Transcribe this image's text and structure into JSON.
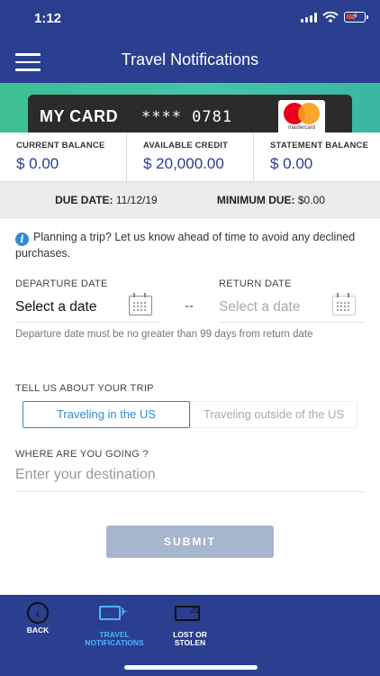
{
  "status_bar": {
    "time": "1:12"
  },
  "header": {
    "title": "Travel Notifications"
  },
  "card": {
    "name": "MY CARD",
    "number": "**** 0781",
    "brand_text": "mastercard"
  },
  "balances": [
    {
      "label": "CURRENT BALANCE",
      "value": "$ 0.00"
    },
    {
      "label": "AVAILABLE CREDIT",
      "value": "$ 20,000.00"
    },
    {
      "label": "STATEMENT BALANCE",
      "value": "$ 0.00"
    }
  ],
  "due": {
    "due_label": "DUE DATE:",
    "due_value": "11/12/19",
    "min_label": "MINIMUM DUE:",
    "min_value": "$0.00"
  },
  "info": {
    "icon": "i",
    "text": "Planning a trip? Let us know ahead of time to avoid any declined purchases."
  },
  "dates": {
    "departure_label": "DEPARTURE DATE",
    "departure_value": "Select a date",
    "separator": "--",
    "return_label": "RETURN DATE",
    "return_value": "Select a date",
    "hint": "Departure date must be no greater than 99 days from return date"
  },
  "trip": {
    "label": "TELL US ABOUT YOUR TRIP",
    "option_us": "Traveling in the US",
    "option_outside": "Traveling outside of the US",
    "selected": "Traveling in the US"
  },
  "destination": {
    "label": "WHERE ARE YOU GOING ?",
    "placeholder": "Enter your destination"
  },
  "submit_label": "SUBMIT",
  "nav": {
    "back": "BACK",
    "travel_1": "TRAVEL",
    "travel_2": "NOTIFICATIONS",
    "lost_1": "LOST OR",
    "lost_2": "STOLEN"
  },
  "colors": {
    "brand": "#2a3f8f",
    "accent": "#2e8bd8",
    "submit": "#a6b6cd",
    "banner": "#3dbf94"
  }
}
